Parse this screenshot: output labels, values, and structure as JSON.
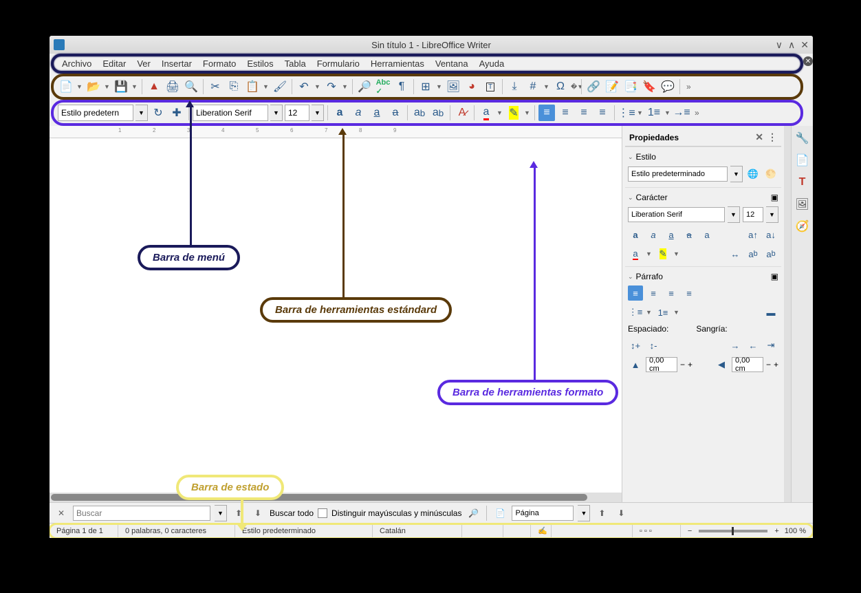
{
  "title": "Sin título 1 - LibreOffice Writer",
  "menu": [
    "Archivo",
    "Editar",
    "Ver",
    "Insertar",
    "Formato",
    "Estilos",
    "Tabla",
    "Formulario",
    "Herramientas",
    "Ventana",
    "Ayuda"
  ],
  "toolbar2": {
    "style": "Estilo predetern",
    "font": "Liberation Serif",
    "size": "12"
  },
  "sidebar": {
    "title": "Propiedades",
    "style_h": "Estilo",
    "style_val": "Estilo predeterminado",
    "char_h": "Carácter",
    "font": "Liberation Serif",
    "size": "12",
    "para_h": "Párrafo",
    "spacing": "Espaciado:",
    "indent": "Sangría:",
    "val1": "0,00 cm",
    "val2": "0,00 cm"
  },
  "find": {
    "placeholder": "Buscar",
    "all": "Buscar todo",
    "case": "Distinguir mayúsculas y minúsculas",
    "page": "Página"
  },
  "status": {
    "page": "Página 1 de 1",
    "words": "0 palabras, 0 caracteres",
    "style": "Estilo predeterminado",
    "lang": "Catalán",
    "zoom": "100 %"
  },
  "callouts": {
    "menu": "Barra de menú",
    "std": "Barra de herramientas estándard",
    "fmt": "Barra de herramientas formato",
    "stat": "Barra de estado"
  }
}
